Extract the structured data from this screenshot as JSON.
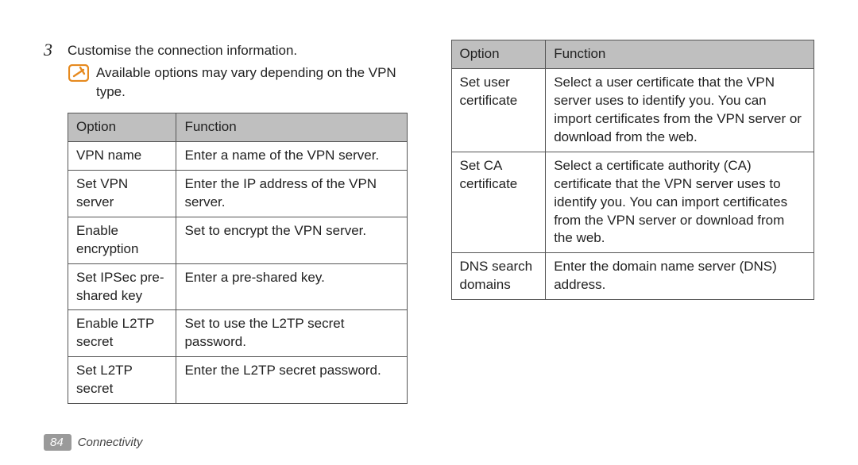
{
  "step": {
    "number": "3",
    "text": "Customise the connection information."
  },
  "note": {
    "text": "Available options may vary depending on the VPN type."
  },
  "table_header": {
    "option": "Option",
    "function": "Function"
  },
  "table1": {
    "rows": [
      {
        "option": "VPN name",
        "function": "Enter a name of the VPN server."
      },
      {
        "option": "Set VPN server",
        "function": "Enter the IP address of the VPN server."
      },
      {
        "option": "Enable encryption",
        "function": "Set to encrypt the VPN server."
      },
      {
        "option": "Set IPSec pre-shared key",
        "function": "Enter a pre-shared key."
      },
      {
        "option": "Enable L2TP secret",
        "function": "Set to use the L2TP secret password."
      },
      {
        "option": "Set L2TP secret",
        "function": "Enter the L2TP secret password."
      }
    ]
  },
  "table2": {
    "rows": [
      {
        "option": "Set user certificate",
        "function": "Select a user certificate that the VPN server uses to identify you. You can import certificates from the VPN server or download from the web."
      },
      {
        "option": "Set CA certificate",
        "function": "Select a certificate authority (CA) certificate that the VPN server uses to identify you. You can import certificates from the VPN server or download from the web."
      },
      {
        "option": "DNS search domains",
        "function": "Enter the domain name server (DNS) address."
      }
    ]
  },
  "footer": {
    "page": "84",
    "section": "Connectivity"
  }
}
